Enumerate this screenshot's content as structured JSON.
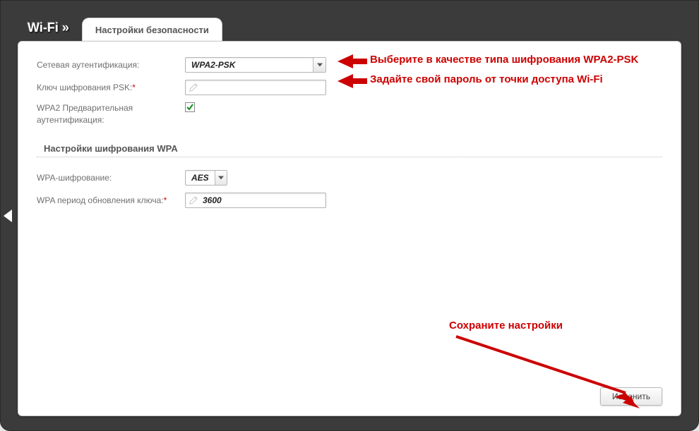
{
  "breadcrumb": "Wi-Fi »",
  "tab_label": "Настройки безопасности",
  "labels": {
    "net_auth": "Сетевая аутентификация:",
    "psk_key": "Ключ шифрования PSK:",
    "wpa2_preauth": "WPA2 Предварительная аутентификация:",
    "section_wpa": "Настройки шифрования WPA",
    "wpa_enc": "WPA-шифрование:",
    "wpa_rekey": "WPA период обновления ключа:"
  },
  "values": {
    "net_auth": "WPA2-PSK",
    "psk_key": "",
    "wpa2_preauth_checked": true,
    "wpa_enc": "AES",
    "wpa_rekey": "3600"
  },
  "button": {
    "save": "Изменить"
  },
  "annotations": {
    "a1": "Выберите в качестве типа шифрования WPA2-PSK",
    "a2": "Задайте свой пароль от точки доступа Wi-Fi",
    "a3": "Сохраните настройки"
  }
}
